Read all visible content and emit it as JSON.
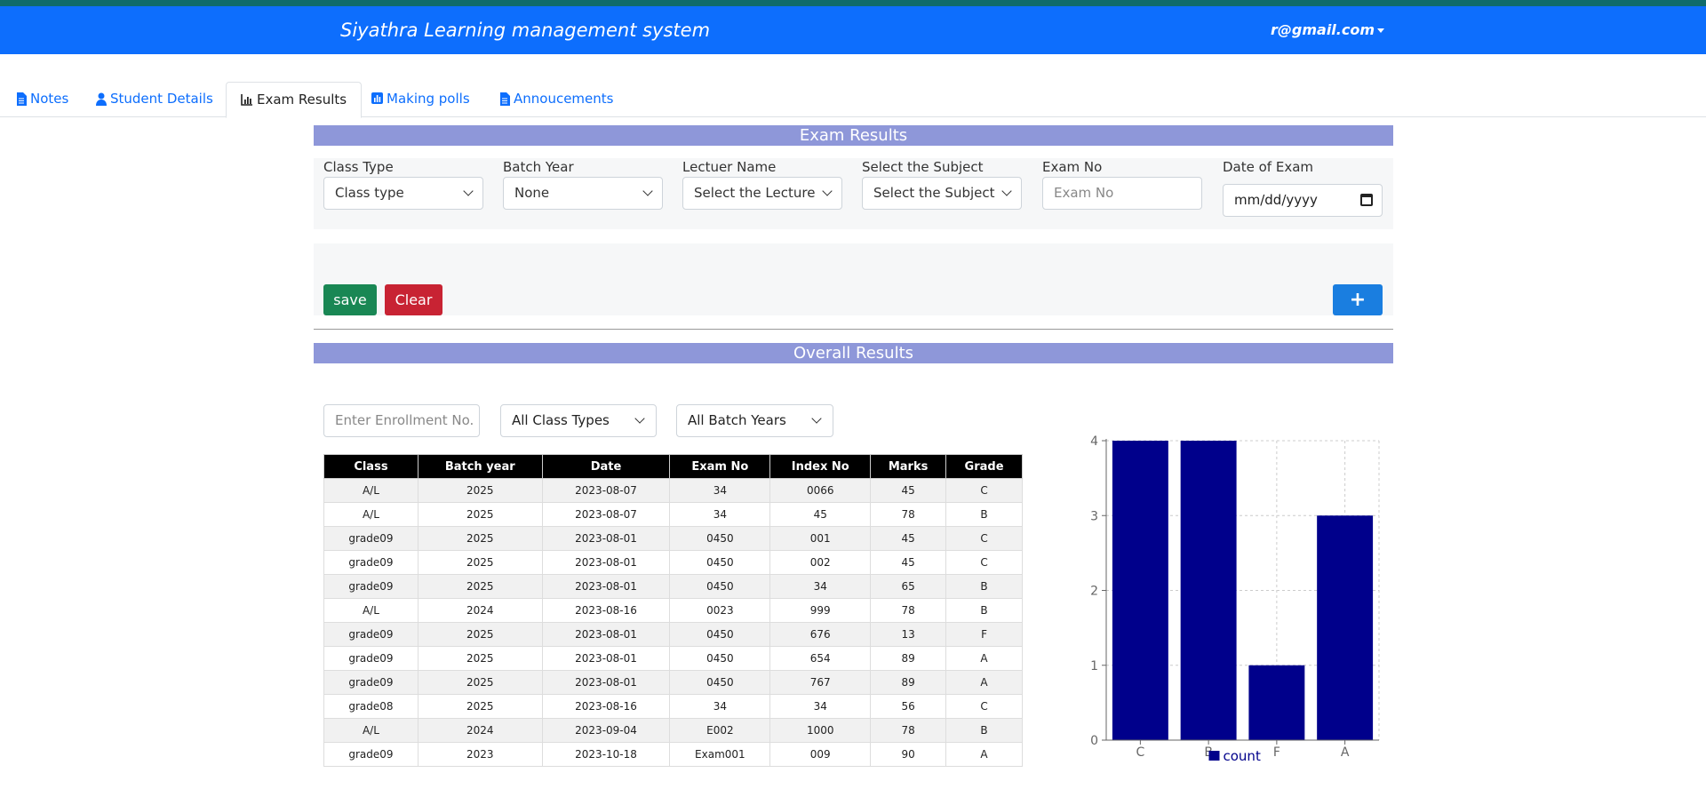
{
  "app": {
    "title": "Siyathra Learning management system",
    "user_email": "r@gmail.com"
  },
  "tabs": [
    {
      "label": "Notes",
      "icon": "file-icon",
      "active": false
    },
    {
      "label": "Student Details",
      "icon": "user-icon",
      "active": false
    },
    {
      "label": "Exam Results",
      "icon": "chart-bar-icon",
      "active": true
    },
    {
      "label": "Making polls",
      "icon": "poll-icon",
      "active": false
    },
    {
      "label": "Annoucements",
      "icon": "file-icon",
      "active": false
    }
  ],
  "exam_section": {
    "heading": "Exam Results",
    "fields": {
      "class_type": {
        "label": "Class Type",
        "value": "Class type"
      },
      "batch_year": {
        "label": "Batch Year",
        "value": "None"
      },
      "lecturer": {
        "label": "Lectuer Name",
        "value": "Select the Lecture"
      },
      "subject": {
        "label": "Select the Subject",
        "value": "Select the Subject"
      },
      "exam_no": {
        "label": "Exam No",
        "placeholder": "Exam No"
      },
      "exam_date": {
        "label": "Date of Exam",
        "placeholder": "mm/dd/yyyy"
      }
    },
    "buttons": {
      "save": "save",
      "clear": "Clear",
      "add": "+"
    }
  },
  "overall_section": {
    "heading": "Overall Results",
    "filters": {
      "enrollment_placeholder": "Enter Enrollment No.",
      "class_types": "All Class Types",
      "batch_years": "All Batch Years"
    },
    "table": {
      "headers": [
        "Class",
        "Batch year",
        "Date",
        "Exam No",
        "Index No",
        "Marks",
        "Grade"
      ],
      "rows": [
        [
          "A/L",
          "2025",
          "2023-08-07",
          "34",
          "0066",
          "45",
          "C"
        ],
        [
          "A/L",
          "2025",
          "2023-08-07",
          "34",
          "45",
          "78",
          "B"
        ],
        [
          "grade09",
          "2025",
          "2023-08-01",
          "0450",
          "001",
          "45",
          "C"
        ],
        [
          "grade09",
          "2025",
          "2023-08-01",
          "0450",
          "002",
          "45",
          "C"
        ],
        [
          "grade09",
          "2025",
          "2023-08-01",
          "0450",
          "34",
          "65",
          "B"
        ],
        [
          "A/L",
          "2024",
          "2023-08-16",
          "0023",
          "999",
          "78",
          "B"
        ],
        [
          "grade09",
          "2025",
          "2023-08-01",
          "0450",
          "676",
          "13",
          "F"
        ],
        [
          "grade09",
          "2025",
          "2023-08-01",
          "0450",
          "654",
          "89",
          "A"
        ],
        [
          "grade09",
          "2025",
          "2023-08-01",
          "0450",
          "767",
          "89",
          "A"
        ],
        [
          "grade08",
          "2025",
          "2023-08-16",
          "34",
          "34",
          "56",
          "C"
        ],
        [
          "A/L",
          "2024",
          "2023-09-04",
          "E002",
          "1000",
          "78",
          "B"
        ],
        [
          "grade09",
          "2023",
          "2023-10-18",
          "Exam001",
          "009",
          "90",
          "A"
        ]
      ]
    }
  },
  "chart_data": {
    "type": "bar",
    "categories": [
      "C",
      "B",
      "F",
      "A"
    ],
    "series": [
      {
        "name": "count",
        "values": [
          4,
          4,
          1,
          3
        ],
        "color": "#00008b"
      }
    ],
    "yticks": [
      0,
      1,
      2,
      3,
      4
    ],
    "ylim": [
      0,
      4
    ],
    "grid": true,
    "legend_position": "bottom"
  },
  "colors": {
    "navbar": "#0d6efd",
    "section_bar": "#8e97d9",
    "save": "#198754",
    "clear": "#c82333",
    "add": "#1a7ee0"
  }
}
